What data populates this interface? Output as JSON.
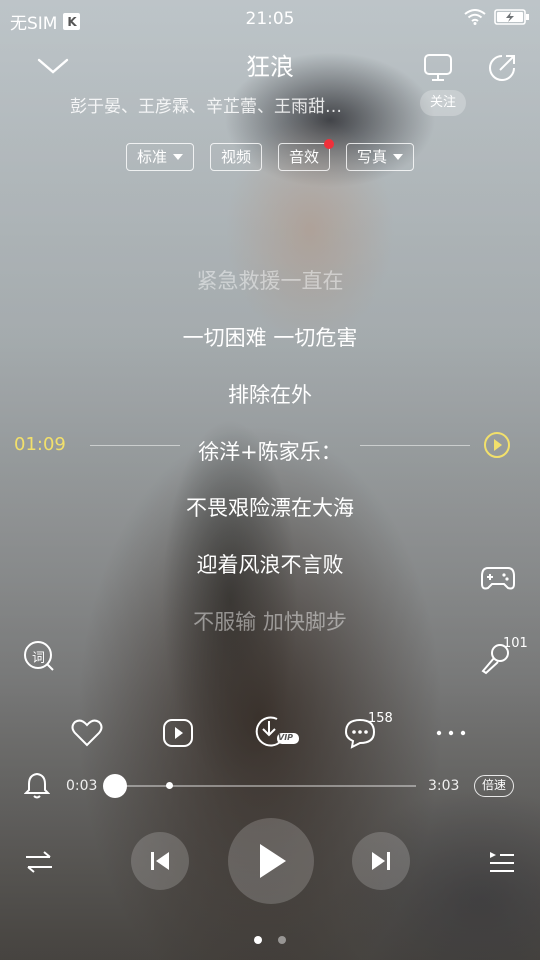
{
  "status_bar": {
    "carrier": "无SIM",
    "app_badge": "K",
    "time": "21:05",
    "icons": [
      "wifi-icon",
      "battery-charging-icon"
    ]
  },
  "header": {
    "title": "狂浪",
    "artists": "彭于晏、王彦霖、辛芷蕾、王雨甜…",
    "follow_label": "关注",
    "icons": [
      "collapse-chevron-icon",
      "tv-cast-icon",
      "share-icon"
    ]
  },
  "chips": {
    "quality": "标准",
    "video": "视频",
    "effects": "音效",
    "photo": "写真",
    "effects_has_notification": true
  },
  "lyrics": {
    "lines": [
      "紧急救援一直在",
      "一切困难 一切危害",
      "排除在外",
      "徐洋+陈家乐：",
      "不畏艰险漂在大海",
      "迎着风浪不言败",
      "不服输 加快脚步"
    ],
    "timeline_time": "01:09",
    "timeline_color": "#f2e06b"
  },
  "side": {
    "lyrics_icon_label": "词",
    "karaoke_count": "101",
    "icons": [
      "gamepad-icon",
      "microphone-icon",
      "lyrics-icon",
      "timeline-play-icon"
    ]
  },
  "actions": {
    "comment_count": "158",
    "vip_label": "VIP",
    "icons": [
      "heart-icon",
      "video-play-icon",
      "download-icon",
      "comment-icon",
      "more-icon"
    ]
  },
  "progress": {
    "current": "0:03",
    "total": "3:03",
    "fraction": 0.017,
    "speed_label": "倍速"
  },
  "controls": {
    "icons": [
      "shuffle-icon",
      "previous-icon",
      "play-icon",
      "next-icon",
      "playlist-icon",
      "alarm-bell-icon"
    ]
  },
  "pager": {
    "count": 2,
    "active": 0
  }
}
